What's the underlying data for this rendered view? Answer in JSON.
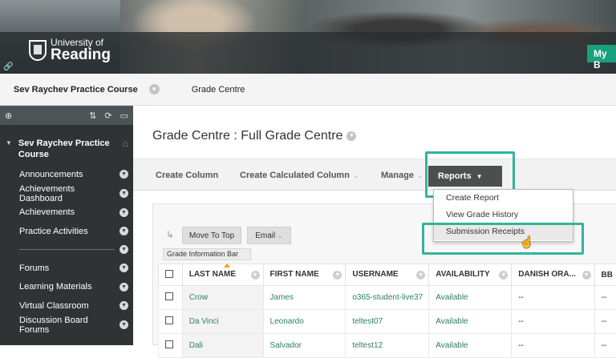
{
  "header": {
    "logo_line1": "University of",
    "logo_line2": "Reading",
    "my_button": "My B"
  },
  "breadcrumb": {
    "course": "Sev Raychev Practice Course",
    "page": "Grade Centre"
  },
  "sidebar": {
    "course_title": "Sev Raychev Practice Course",
    "items": [
      {
        "label": "Announcements"
      },
      {
        "label": "Achievements Dashboard"
      },
      {
        "label": "Achievements"
      },
      {
        "label": "Practice Activities"
      },
      {
        "label": ""
      },
      {
        "label": "Forums"
      },
      {
        "label": "Learning Materials"
      },
      {
        "label": "Virtual Classroom"
      },
      {
        "label": "Discussion Board Forums"
      }
    ]
  },
  "main": {
    "title": "Grade Centre : Full Grade Centre",
    "actions": {
      "create_column": "Create Column",
      "create_calculated_column": "Create Calculated Column",
      "manage": "Manage",
      "reports": "Reports"
    },
    "reports_menu": [
      "Create Report",
      "View Grade History",
      "Submission Receipts"
    ],
    "grid_buttons": {
      "move_to_top": "Move To Top",
      "email": "Email"
    },
    "info_bar": "Grade Information Bar",
    "columns": [
      "LAST NAME",
      "FIRST NAME",
      "USERNAME",
      "AVAILABILITY",
      "DANISH ORA...",
      "BB"
    ],
    "rows": [
      [
        "Crow",
        "James",
        "o365-student-live37",
        "Available",
        "--",
        "--"
      ],
      [
        "Da Vinci",
        "Leonardo",
        "teltest07",
        "Available",
        "--",
        "--"
      ],
      [
        "Dali",
        "Salvador",
        "teltest12",
        "Available",
        "--",
        "--"
      ]
    ]
  }
}
